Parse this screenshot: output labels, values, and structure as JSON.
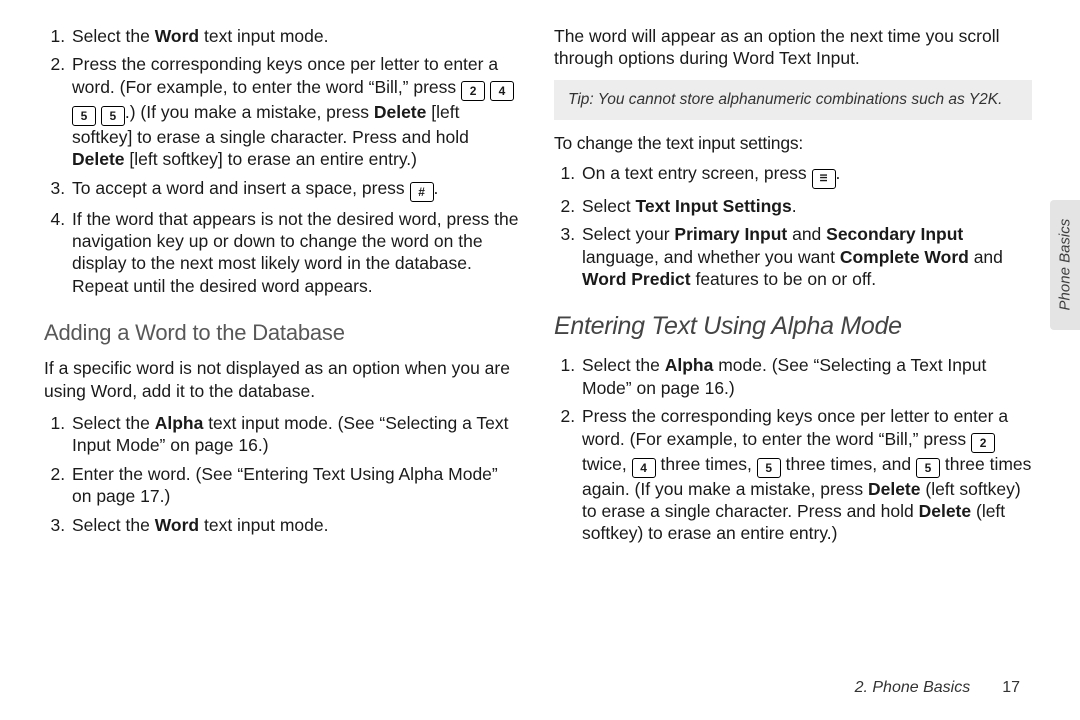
{
  "left": {
    "steps1": {
      "i1_a": "Select the ",
      "i1_b": "Word",
      "i1_c": " text input mode.",
      "i2_a": "Press the corresponding keys once per letter to enter a word. (For example, to enter the word “Bill,” press ",
      "i2_keys": [
        "2",
        "4",
        "5",
        "5"
      ],
      "i2_b": ".) (If you make a mistake, press ",
      "i2_c": "Delete",
      "i2_d": " [left softkey] to erase a single character. Press and hold ",
      "i2_e": "Delete",
      "i2_f": " [left softkey] to erase an entire entry.)",
      "i3_a": "To accept a word and insert a space, press ",
      "i3_key": "#",
      "i3_b": ".",
      "i4": "If the word that appears is not the desired word, press the navigation key up or down to change the word on the display to the next most likely word in the database. Repeat until the desired word appears."
    },
    "heading_add": "Adding a Word to the Database",
    "add_intro": "If a specific word is not displayed as an option when you are using Word, add it to the database.",
    "steps2": {
      "i1_a": "Select the ",
      "i1_b": "Alpha",
      "i1_c": " text input mode. (See “Selecting a Text Input Mode” on page 16.)",
      "i2": "Enter the word. (See “Entering Text Using Alpha Mode” on page 17.)",
      "i3_a": "Select the ",
      "i3_b": "Word",
      "i3_c": " text input mode."
    }
  },
  "right": {
    "intro": "The word will appear as an option the next time you scroll through options during Word Text Input.",
    "tip_label": "Tip:",
    "tip_body": " You cannot store alphanumeric combinations such as Y2K.",
    "change_lead": "To change the text input settings:",
    "steps3": {
      "i1_a": "On a text entry screen, press ",
      "i1_key": "☰",
      "i1_b": ".",
      "i2_a": "Select ",
      "i2_b": "Text Input Settings",
      "i2_c": ".",
      "i3_a": "Select your ",
      "i3_b": "Primary Input",
      "i3_c": " and ",
      "i3_d": "Secondary Input",
      "i3_e": " language, and whether you want ",
      "i3_f": "Complete Word",
      "i3_g": " and ",
      "i3_h": "Word Predict",
      "i3_i": " features to be on or off."
    },
    "heading_alpha": "Entering Text Using Alpha Mode",
    "steps4": {
      "i1_a": "Select the ",
      "i1_b": "Alpha",
      "i1_c": " mode. (See “Selecting a Text Input Mode” on page 16.)",
      "i2_a": "Press the corresponding keys once per letter to enter a word. (For example, to enter the word “Bill,” press ",
      "i2_k1": "2",
      "i2_b": " twice, ",
      "i2_k2": "4",
      "i2_c": " three times, ",
      "i2_k3": "5",
      "i2_d": " three times, and ",
      "i2_k4": "5",
      "i2_e": " three times again. (If you make a mistake, press ",
      "i2_f": "Delete",
      "i2_g": " (left softkey) to erase a single character. Press and hold ",
      "i2_h": "Delete",
      "i2_i": " (left softkey) to erase an entire entry.)"
    }
  },
  "side_tab": "Phone Basics",
  "footer_section": "2. Phone Basics",
  "footer_page": "17"
}
